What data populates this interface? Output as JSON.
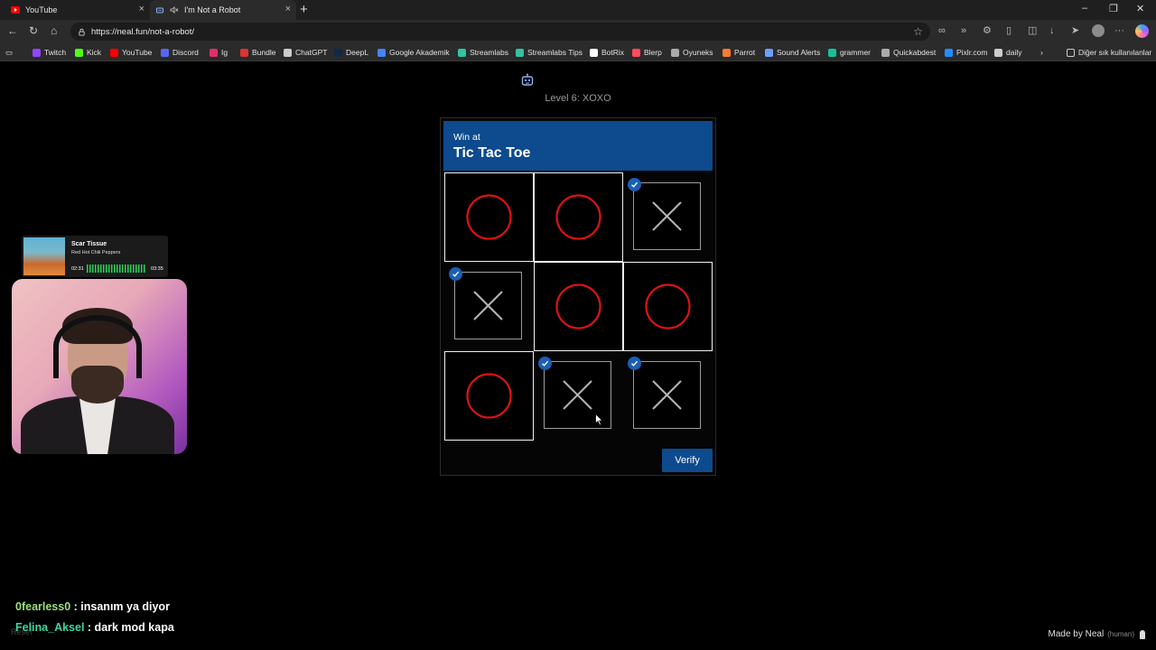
{
  "browser": {
    "tabs": [
      {
        "title": "YouTube",
        "icon": "youtube-icon",
        "active": false
      },
      {
        "title": "I'm Not a Robot",
        "icon": "robot-muted-icon",
        "active": true
      }
    ],
    "url": "https://neal.fun/not-a-robot/",
    "bookmarks": [
      {
        "label": "Twitch",
        "color": "#9146ff"
      },
      {
        "label": "Kick",
        "color": "#53fc18"
      },
      {
        "label": "YouTube",
        "color": "#ff0000"
      },
      {
        "label": "Discord",
        "color": "#5865f2"
      },
      {
        "label": "Ig",
        "color": "#e1306c"
      },
      {
        "label": "Bundle",
        "color": "#d33"
      },
      {
        "label": "ChatGPT",
        "color": "#cccccc"
      },
      {
        "label": "DeepL",
        "color": "#0f2b46"
      },
      {
        "label": "Google Akademik",
        "color": "#4285f4"
      },
      {
        "label": "Streamlabs",
        "color": "#31c3a2"
      },
      {
        "label": "Streamlabs Tips",
        "color": "#31c3a2"
      },
      {
        "label": "BotRix",
        "color": "#ffffff"
      },
      {
        "label": "Blerp",
        "color": "#ff4b5c"
      },
      {
        "label": "Oyuneks",
        "color": "#aaaaaa"
      },
      {
        "label": "Parrot",
        "color": "#ff7a2f"
      },
      {
        "label": "Sound Alerts",
        "color": "#6aa0ff"
      },
      {
        "label": "grammer",
        "color": "#15c39a"
      },
      {
        "label": "Quickabdest",
        "color": "#aaaaaa"
      },
      {
        "label": "Pixlr.com",
        "color": "#1f8fff"
      },
      {
        "label": "daily",
        "color": "#cccccc"
      }
    ],
    "other_bookmarks": "Diğer sık kullanılanlar"
  },
  "page": {
    "level": "Level 6: XOXO",
    "header_small": "Win at",
    "header_big": "Tic Tac Toe",
    "verify_label": "Verify",
    "board": [
      "O",
      "O",
      "X",
      "X",
      "O",
      "O",
      "O",
      "X",
      "X"
    ],
    "checked": [
      false,
      false,
      true,
      true,
      false,
      false,
      false,
      true,
      true
    ],
    "o_color": "#e01212",
    "x_color": "#b5b5b5",
    "accent": "#0d4a8e",
    "made_by": "Made by Neal",
    "made_by_note": "(human)",
    "reset": "Reset"
  },
  "overlay": {
    "now_playing": {
      "song": "Scar Tissue",
      "artist": "Red Hot Chili Peppers",
      "elapsed": "02:31",
      "duration": "03:35"
    },
    "chat": [
      {
        "user": "0fearless0",
        "message": ": insanım ya diyor"
      },
      {
        "user": "Felina_Aksel",
        "message": ": dark mod kapa"
      }
    ]
  }
}
